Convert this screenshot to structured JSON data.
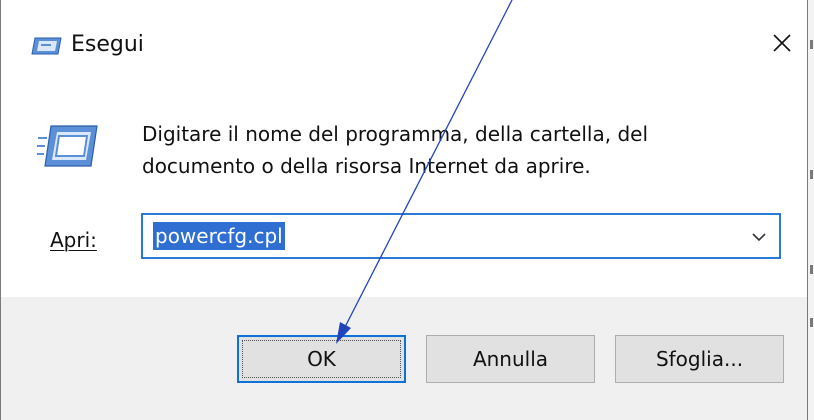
{
  "dialog": {
    "title": "Esegui",
    "app_icon": "run-icon",
    "close_icon": "close-icon",
    "description": "Digitare il nome del programma, della cartella, del documento o della risorsa Internet da aprire.",
    "open_label": "Apri:",
    "open_value": "powercfg.cpl",
    "dropdown_icon": "chevron-down-icon",
    "buttons": {
      "ok": "OK",
      "cancel": "Annulla",
      "browse": "Sfoglia..."
    }
  },
  "colors": {
    "accent": "#2a7ad6",
    "selection": "#2f6fd1",
    "footer_bg": "#f0f0f0",
    "button_bg": "#e1e1e1",
    "annotation_arrow": "#2244bb"
  }
}
